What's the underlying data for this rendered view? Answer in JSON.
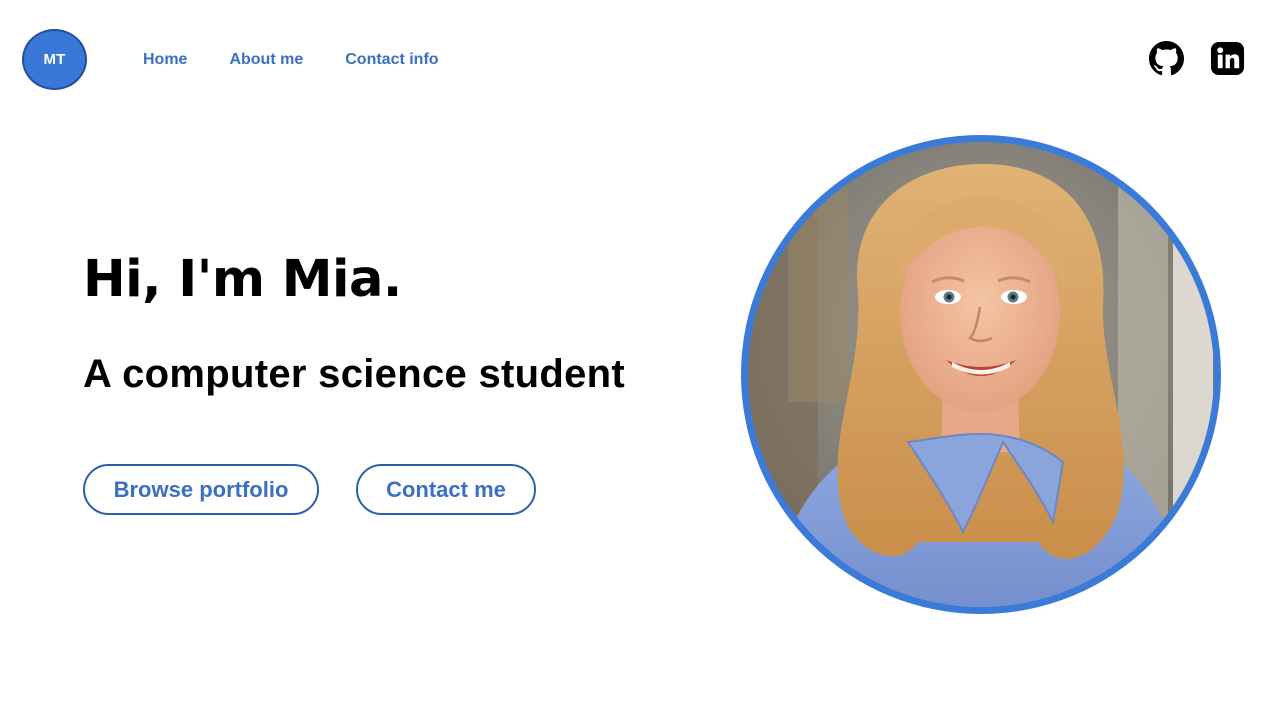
{
  "header": {
    "logo_text": "MT",
    "nav": [
      {
        "label": "Home"
      },
      {
        "label": "About me"
      },
      {
        "label": "Contact info"
      }
    ],
    "social": [
      {
        "icon": "github-icon"
      },
      {
        "icon": "linkedin-icon"
      }
    ]
  },
  "hero": {
    "title": "Hi, I'm Mia.",
    "subtitle": "A computer science student",
    "buttons": {
      "browse_label": "Browse portfolio",
      "contact_label": "Contact me"
    }
  },
  "portrait": {
    "subject": "portrait-photo"
  },
  "colors": {
    "accent": "#3a7bd9",
    "link": "#3a6fc2",
    "button_border": "#2b5fa8"
  }
}
